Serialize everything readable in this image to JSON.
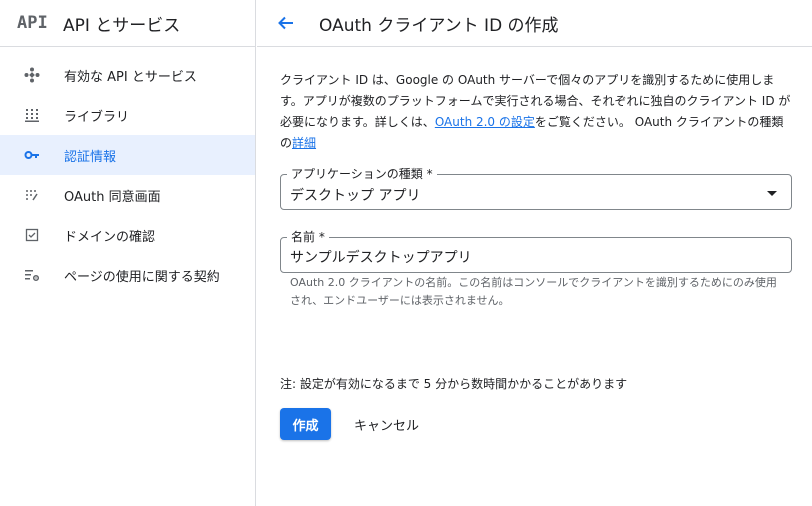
{
  "sidebar": {
    "logo": "API",
    "title": "API とサービス",
    "items": [
      {
        "label": "有効な API とサービス",
        "icon": "api-diamond-icon",
        "active": false
      },
      {
        "label": "ライブラリ",
        "icon": "library-icon",
        "active": false
      },
      {
        "label": "認証情報",
        "icon": "key-icon",
        "active": true
      },
      {
        "label": "OAuth 同意画面",
        "icon": "consent-dots-icon",
        "active": false
      },
      {
        "label": "ドメインの確認",
        "icon": "checkbox-icon",
        "active": false
      },
      {
        "label": "ページの使用に関する契約",
        "icon": "settings-list-icon",
        "active": false
      }
    ]
  },
  "header": {
    "title": "OAuth クライアント ID の作成"
  },
  "main": {
    "desc_part1": "クライアント ID は、Google の OAuth サーバーで個々のアプリを識別するために使用します。アプリが複数のプラットフォームで実行される場合、それぞれに独自のクライアント ID が必要になります。詳しくは、",
    "desc_link1": "OAuth 2.0 の設定",
    "desc_part2": "をご覧ください。 OAuth クライアントの種類の",
    "desc_link2": "詳細",
    "app_type": {
      "label": "アプリケーションの種類 *",
      "value": "デスクトップ アプリ"
    },
    "name_field": {
      "label": "名前 *",
      "value": "サンプルデスクトップアプリ",
      "helper": "OAuth 2.0 クライアントの名前。この名前はコンソールでクライアントを識別するためにのみ使用され、エンドユーザーには表示されません。"
    },
    "note": "注: 設定が有効になるまで 5 分から数時間かかることがあります",
    "create_label": "作成",
    "cancel_label": "キャンセル"
  },
  "colors": {
    "accent": "#1a73e8",
    "active_bg": "#e8f0fe",
    "border": "#dadce0"
  }
}
